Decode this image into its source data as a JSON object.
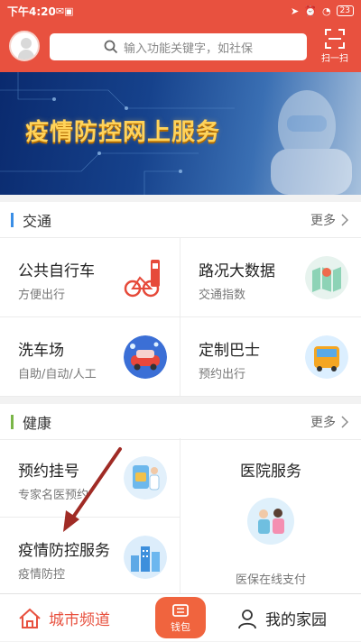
{
  "status_bar": {
    "time": "下午4:20",
    "battery": "23"
  },
  "header": {
    "search_placeholder": "输入功能关键字，如社保",
    "scan_label": "扫一扫"
  },
  "banner": {
    "title": "疫情防控网上服务"
  },
  "transport": {
    "title": "交通",
    "more": "更多",
    "accent": "#3a8ee6",
    "items": [
      {
        "title": "公共自行车",
        "subtitle": "方便出行",
        "icon": "bicycle-icon"
      },
      {
        "title": "路况大数据",
        "subtitle": "交通指数",
        "icon": "map-icon"
      },
      {
        "title": "洗车场",
        "subtitle": "自助/自动/人工",
        "icon": "car-wash-icon"
      },
      {
        "title": "定制巴士",
        "subtitle": "预约出行",
        "icon": "bus-icon"
      }
    ]
  },
  "health": {
    "title": "健康",
    "more": "更多",
    "accent": "#7ab648",
    "items": [
      {
        "title": "预约挂号",
        "subtitle": "专家名医预约",
        "icon": "registration-icon"
      },
      {
        "title": "医院服务",
        "subtitle": "医保在线支付",
        "icon": "hospital-icon"
      },
      {
        "title": "疫情防控服务",
        "subtitle": "疫情防控",
        "icon": "city-icon"
      }
    ]
  },
  "tabbar": {
    "city_channel": "城市频道",
    "wallet": "钱包",
    "my_home": "我的家园",
    "accent": "#e8513f"
  }
}
